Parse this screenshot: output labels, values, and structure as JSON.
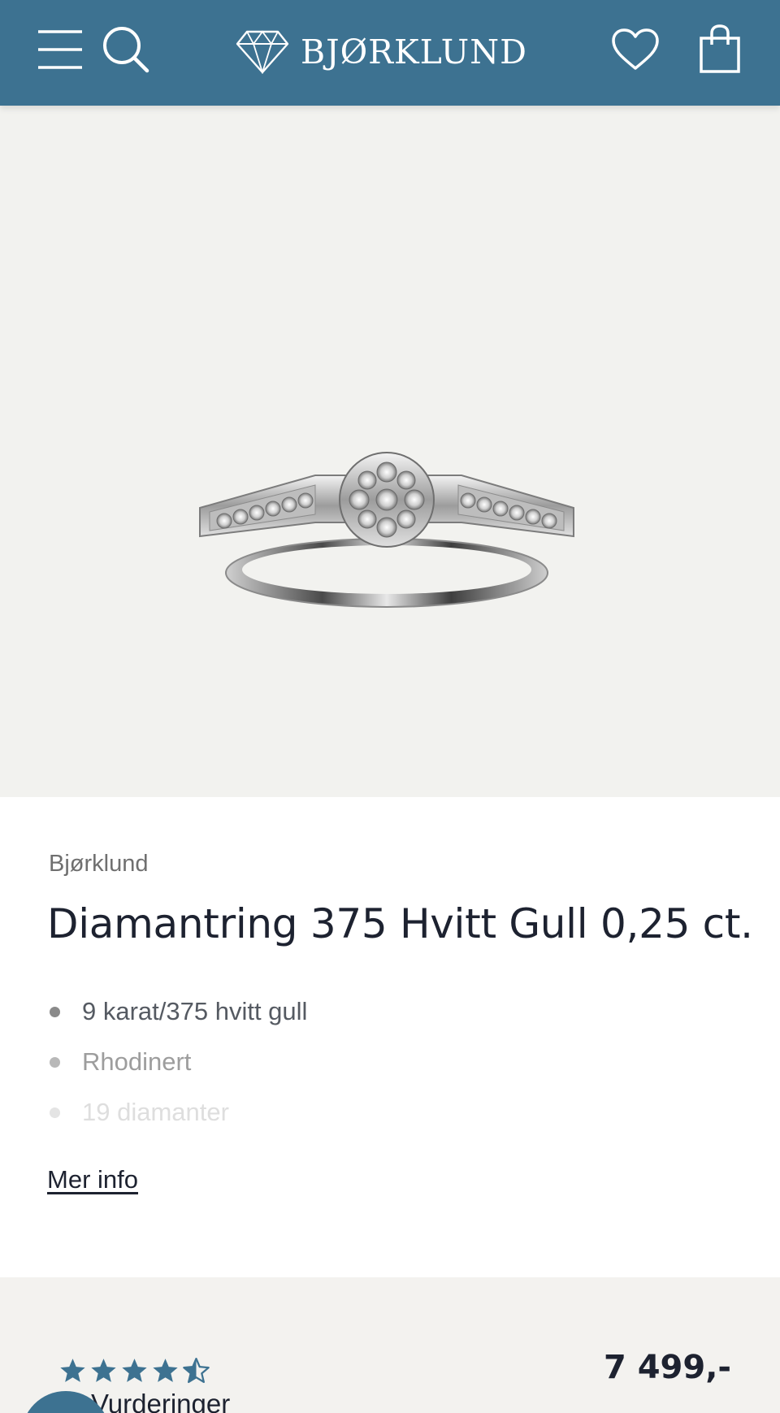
{
  "header": {
    "logo_text": "BJØRKLUND",
    "icons": [
      "menu-icon",
      "search-icon",
      "diamond-logo-icon",
      "heart-icon",
      "shopping-bag-icon"
    ],
    "background": "#3d7291"
  },
  "gallery": {
    "image_count": 4,
    "active_index": 0,
    "background": "#f2f2ef"
  },
  "product": {
    "brand": "Bjørklund",
    "title": "Diamantring 375 Hvitt Gull 0,25 ct.",
    "features": [
      "9 karat/375 hvitt gull",
      "Rhodinert",
      "19 diamanter"
    ],
    "more_info_label": "Mer info"
  },
  "purchase": {
    "price": "7 499,-",
    "rating": 4.5,
    "rating_max": 5,
    "reviews_label": "Vurderinger"
  },
  "colors": {
    "accent": "#3d7291",
    "text": "#1d2230",
    "muted": "#6f6f6f"
  }
}
